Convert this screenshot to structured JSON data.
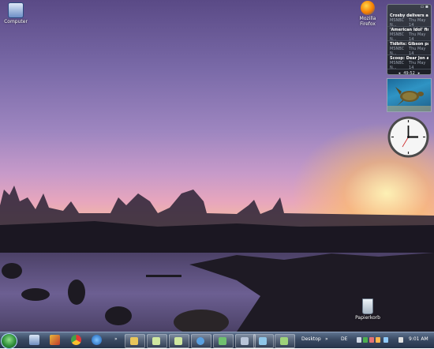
{
  "desktop": {
    "icons": [
      {
        "name": "computer-icon",
        "label": "Computer"
      },
      {
        "name": "firefox-icon",
        "label": "Mozilla Firefox"
      },
      {
        "name": "recycle-bin-icon",
        "label": "Papierkorb"
      }
    ]
  },
  "gadgets": {
    "rss": {
      "items": [
        {
          "title": "Crosby delivers as Pe...",
          "source": "MSNBC N...",
          "date": "Thu May 14"
        },
        {
          "title": "'American Idol' finali...",
          "source": "MSNBC N...",
          "date": "Thu May 14"
        },
        {
          "title": "Tidbits: Gibson paid ...",
          "source": "MSNBC N...",
          "date": "Thu May 14"
        },
        {
          "title": "Scoop: Dear Jon and ...",
          "source": "MSNBC N...",
          "date": "Thu May 14"
        }
      ],
      "pager": "49-52"
    }
  },
  "taskbar": {
    "desktop_label": "Desktop",
    "language": "DE",
    "clock": "9:01 AM"
  },
  "colors": {
    "taskbar": "#2c3a52",
    "start_orb": "#2f8f3a"
  }
}
